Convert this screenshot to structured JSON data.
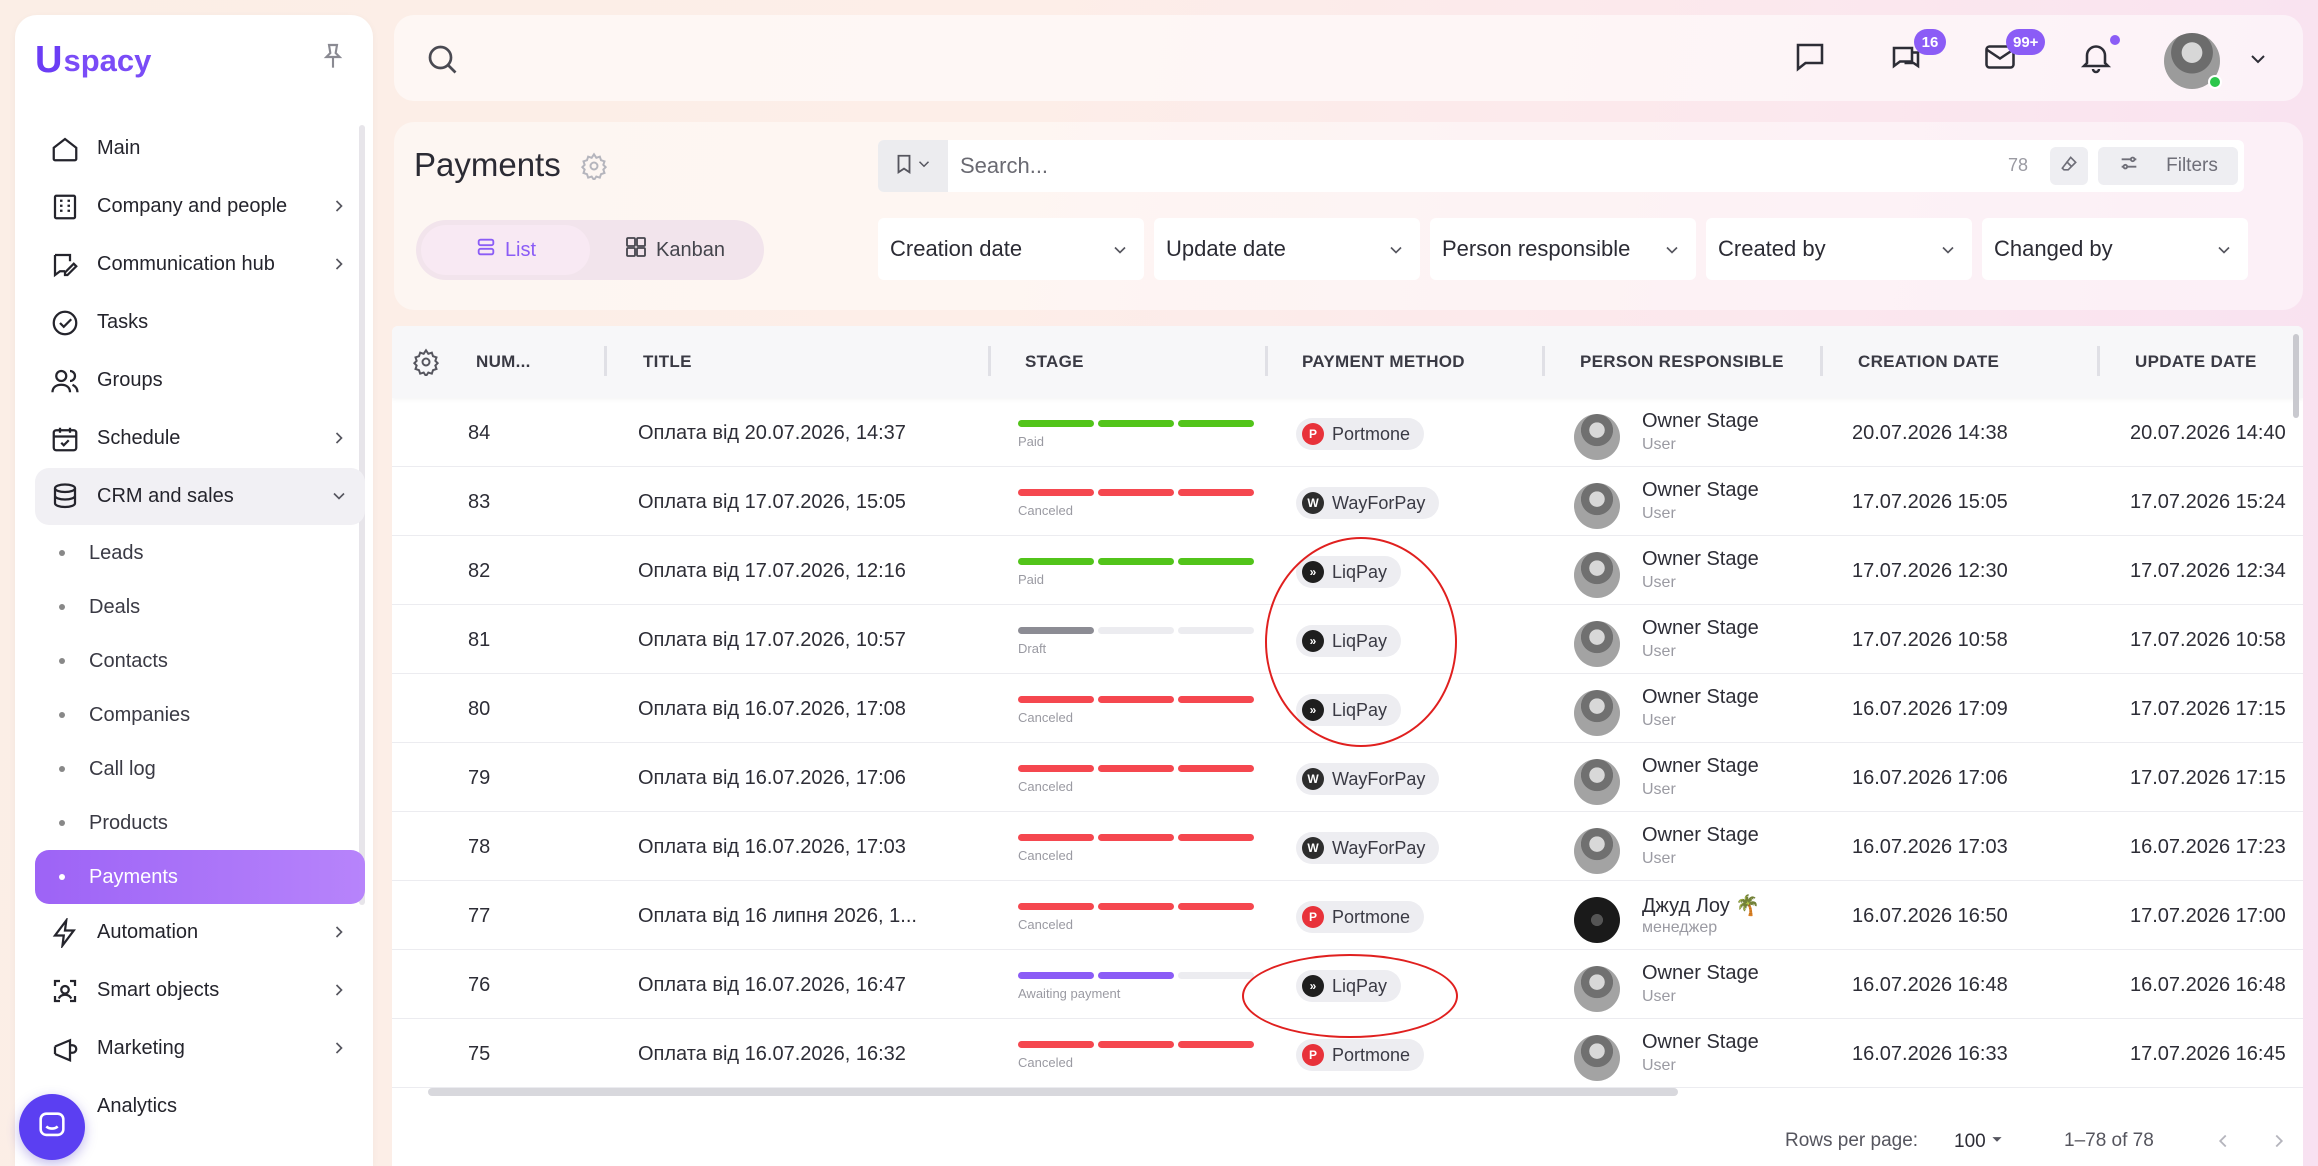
{
  "app": {
    "logo": "spacy",
    "logo_mark": "U"
  },
  "sidebar": {
    "items": [
      {
        "label": "Main",
        "icon": "home-icon"
      },
      {
        "label": "Company and people",
        "icon": "building-icon"
      },
      {
        "label": "Communication hub",
        "icon": "chat-edit-icon"
      },
      {
        "label": "Tasks",
        "icon": "check-circle-icon"
      },
      {
        "label": "Groups",
        "icon": "users-icon"
      },
      {
        "label": "Schedule",
        "icon": "calendar-icon"
      },
      {
        "label": "CRM and sales",
        "icon": "database-icon"
      }
    ],
    "sub_items": [
      "Leads",
      "Deals",
      "Contacts",
      "Companies",
      "Call log",
      "Products",
      "Payments"
    ],
    "items_after": [
      {
        "label": "Automation",
        "icon": "bolt-icon"
      },
      {
        "label": "Smart objects",
        "icon": "scan-icon"
      },
      {
        "label": "Marketing",
        "icon": "megaphone-icon"
      },
      {
        "label": "Analytics",
        "icon": "chart-icon"
      }
    ]
  },
  "topbar": {
    "chat_badge": "16",
    "mail_badge": "99+"
  },
  "header": {
    "title": "Payments",
    "view_list": "List",
    "view_kanban": "Kanban",
    "search_placeholder": "Search...",
    "count": "78",
    "filters_label": "Filters",
    "filter_dropdowns": [
      "Creation date",
      "Update date",
      "Person responsible",
      "Created by",
      "Changed by"
    ]
  },
  "table": {
    "columns": [
      "NUM...",
      "TITLE",
      "STAGE",
      "PAYMENT METHOD",
      "PERSON RESPONSIBLE",
      "CREATION DATE",
      "UPDATE DATE"
    ],
    "rows": [
      {
        "num": "84",
        "title": "Оплата від 20.07.2026, 14:37",
        "stage": "Paid",
        "method": "Portmone",
        "person": "Owner Stage",
        "role": "User",
        "created": "20.07.2026 14:38",
        "updated": "20.07.2026 14:40"
      },
      {
        "num": "83",
        "title": "Оплата від 17.07.2026, 15:05",
        "stage": "Canceled",
        "method": "WayForPay",
        "person": "Owner Stage",
        "role": "User",
        "created": "17.07.2026 15:05",
        "updated": "17.07.2026 15:24"
      },
      {
        "num": "82",
        "title": "Оплата від 17.07.2026, 12:16",
        "stage": "Paid",
        "method": "LiqPay",
        "person": "Owner Stage",
        "role": "User",
        "created": "17.07.2026 12:30",
        "updated": "17.07.2026 12:34"
      },
      {
        "num": "81",
        "title": "Оплата від 17.07.2026, 10:57",
        "stage": "Draft",
        "method": "LiqPay",
        "person": "Owner Stage",
        "role": "User",
        "created": "17.07.2026 10:58",
        "updated": "17.07.2026 10:58"
      },
      {
        "num": "80",
        "title": "Оплата від 16.07.2026, 17:08",
        "stage": "Canceled",
        "method": "LiqPay",
        "person": "Owner Stage",
        "role": "User",
        "created": "16.07.2026 17:09",
        "updated": "17.07.2026 17:15"
      },
      {
        "num": "79",
        "title": "Оплата від 16.07.2026, 17:06",
        "stage": "Canceled",
        "method": "WayForPay",
        "person": "Owner Stage",
        "role": "User",
        "created": "16.07.2026 17:06",
        "updated": "17.07.2026 17:15"
      },
      {
        "num": "78",
        "title": "Оплата від 16.07.2026, 17:03",
        "stage": "Canceled",
        "method": "WayForPay",
        "person": "Owner Stage",
        "role": "User",
        "created": "16.07.2026 17:03",
        "updated": "16.07.2026 17:23"
      },
      {
        "num": "77",
        "title": "Оплата від 16 липня 2026, 1...",
        "stage": "Canceled",
        "method": "Portmone",
        "person": "Джуд Лоу 🌴",
        "role": "менеджер",
        "created": "16.07.2026 16:50",
        "updated": "17.07.2026 17:00"
      },
      {
        "num": "76",
        "title": "Оплата від 16.07.2026, 16:47",
        "stage": "Awaiting payment",
        "method": "LiqPay",
        "person": "Owner Stage",
        "role": "User",
        "created": "16.07.2026 16:48",
        "updated": "16.07.2026 16:48"
      },
      {
        "num": "75",
        "title": "Оплата від 16.07.2026, 16:32",
        "stage": "Canceled",
        "method": "Portmone",
        "person": "Owner Stage",
        "role": "User",
        "created": "16.07.2026 16:33",
        "updated": "17.07.2026 16:45"
      }
    ]
  },
  "footer": {
    "rows_per_page_label": "Rows per page:",
    "rows_per_page": "100",
    "range": "1–78 of 78"
  },
  "colors": {
    "accent": "#8b5cf6",
    "paid": "#52c41a",
    "canceled": "#f5474f",
    "draft": "#8c8c94",
    "awaiting": "#8b5cf6",
    "annotation": "#e0201f"
  }
}
